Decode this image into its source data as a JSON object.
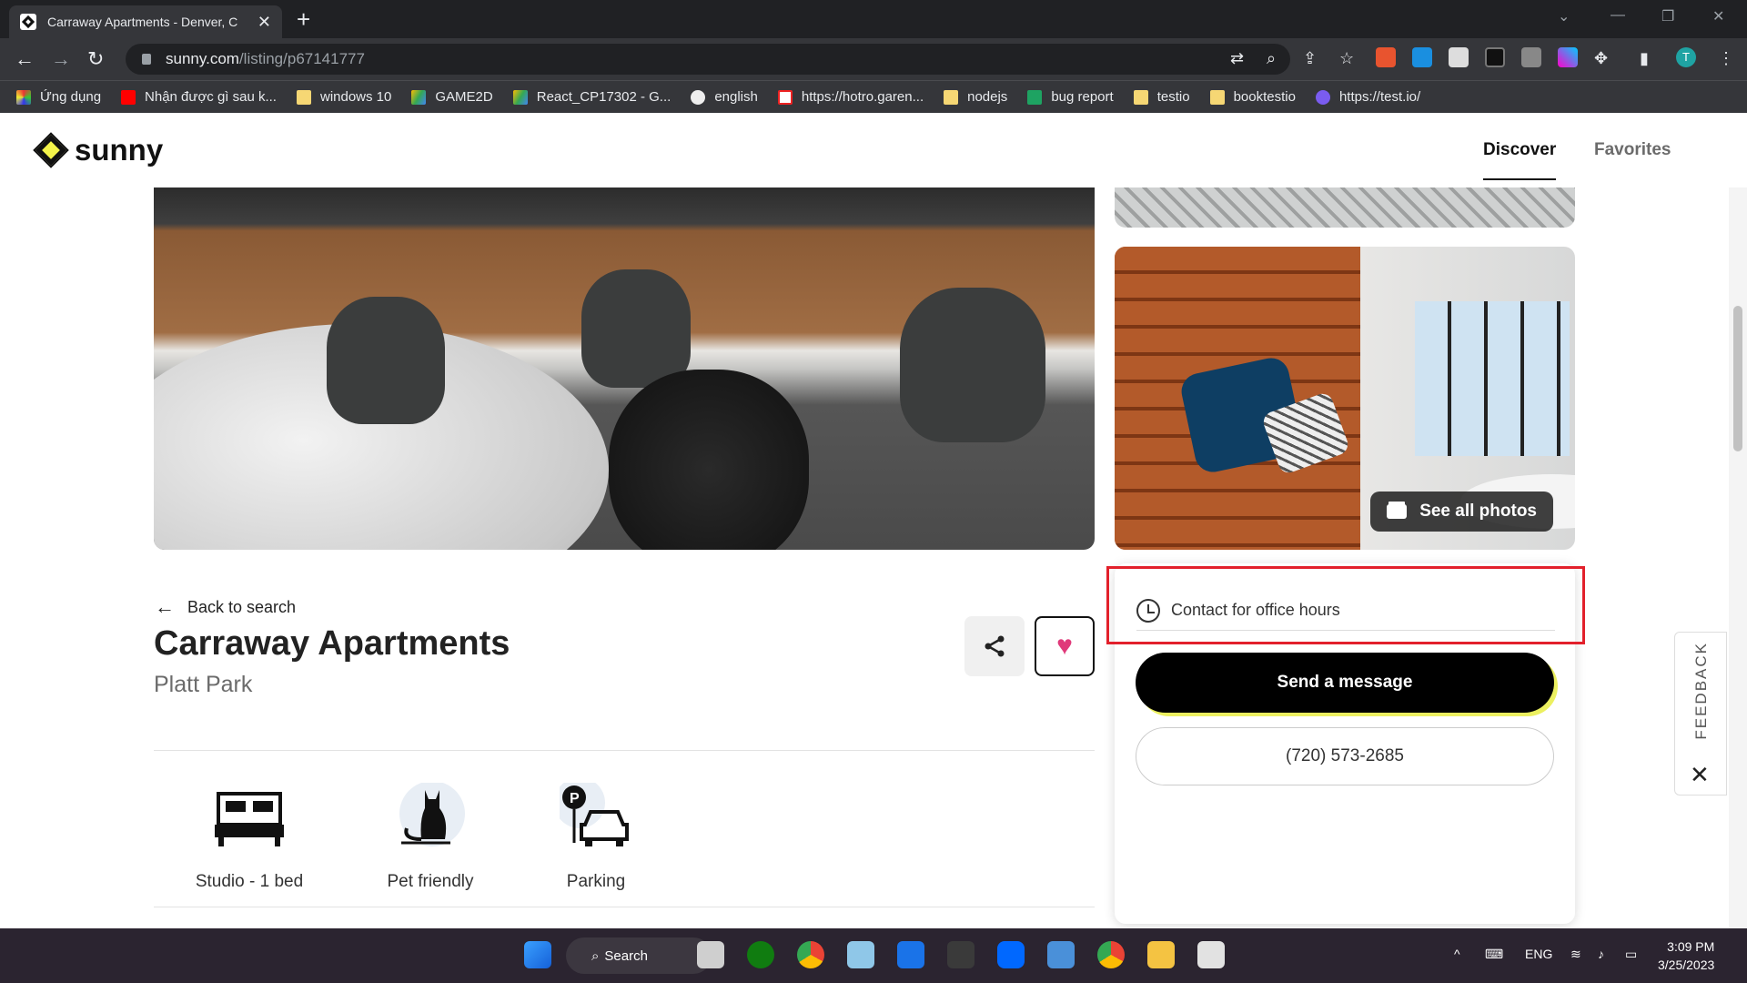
{
  "browser": {
    "tab_title": "Carraway Apartments - Denver, C",
    "url_domain": "sunny.com",
    "url_path": "/listing/p67141777",
    "bookmarks": [
      "Ứng dụng",
      "Nhận được gì sau k...",
      "windows 10",
      "GAME2D",
      "React_CP17302 - G...",
      "english",
      "https://hotro.garen...",
      "nodejs",
      "bug report",
      "testio",
      "booktestio",
      "https://test.io/"
    ],
    "profile_initial": "T"
  },
  "site": {
    "logo_text": "sunny",
    "nav": [
      "Discover",
      "Favorites"
    ]
  },
  "listing": {
    "see_all_photos": "See all photos",
    "back_label": "Back to search",
    "title": "Carraway Apartments",
    "neighborhood": "Platt Park",
    "amenities": [
      "Studio - 1 bed",
      "Pet friendly",
      "Parking"
    ]
  },
  "contact": {
    "hours": "Contact for office hours",
    "send_message": "Send a message",
    "phone": "(720) 573-2685"
  },
  "feedback": {
    "label": "FEEDBACK"
  },
  "taskbar": {
    "search": "Search",
    "lang": "ENG",
    "time": "3:09 PM",
    "date": "3/25/2023"
  },
  "colors": {
    "accent": "#ecf060",
    "heart": "#e0397a",
    "highlight": "#e2202b"
  }
}
